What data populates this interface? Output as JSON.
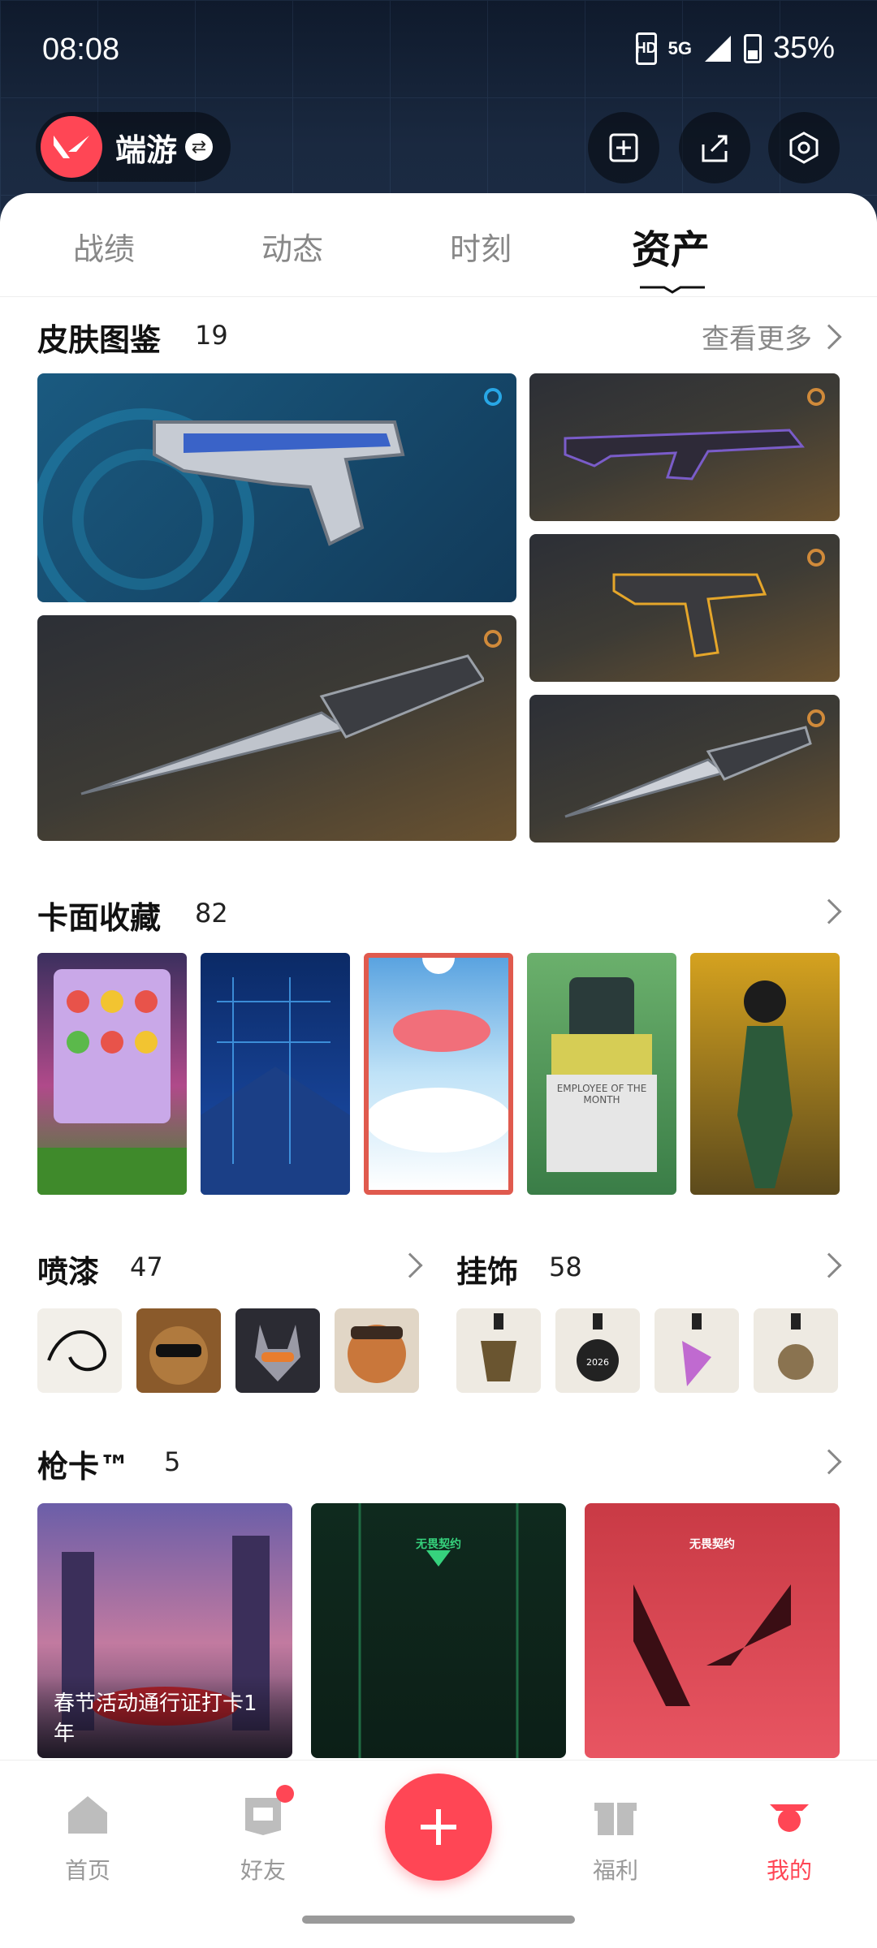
{
  "status_bar": {
    "time": "08:08",
    "network": "5G",
    "hd_label": "HD",
    "battery": "35%"
  },
  "profile": {
    "name": "端游",
    "swap_icon": "swap-icon"
  },
  "header_actions": [
    "card-edit-icon",
    "share-icon",
    "settings-icon"
  ],
  "tabs": [
    "战绩",
    "动态",
    "时刻",
    "资产"
  ],
  "active_tab": "资产",
  "skins": {
    "title": "皮肤图鉴",
    "count": "19",
    "more_label": "查看更多"
  },
  "cards": {
    "title": "卡面收藏",
    "count": "82"
  },
  "sprays": {
    "title": "喷漆",
    "count": "47"
  },
  "charms": {
    "title": "挂饰",
    "count": "58"
  },
  "gun_cards": {
    "title": "枪卡™",
    "count": "5",
    "items": [
      {
        "caption": "春节活动通行证打卡1年"
      },
      {
        "badge": "无畏契约"
      },
      {
        "badge": "无畏契约"
      }
    ]
  },
  "card_item_text": "EMPLOYEE OF THE MONTH",
  "charm_item_text": "2026",
  "nav": {
    "items": [
      {
        "label": "首页",
        "icon": "home-icon"
      },
      {
        "label": "好友",
        "icon": "friends-icon"
      },
      {
        "label": "福利",
        "icon": "gift-icon"
      },
      {
        "label": "我的",
        "icon": "profile-agent-icon"
      }
    ],
    "active": "我的",
    "fab_icon": "plus-icon"
  },
  "colors": {
    "accent": "#ff4655",
    "header_bg": "#1a2940"
  }
}
